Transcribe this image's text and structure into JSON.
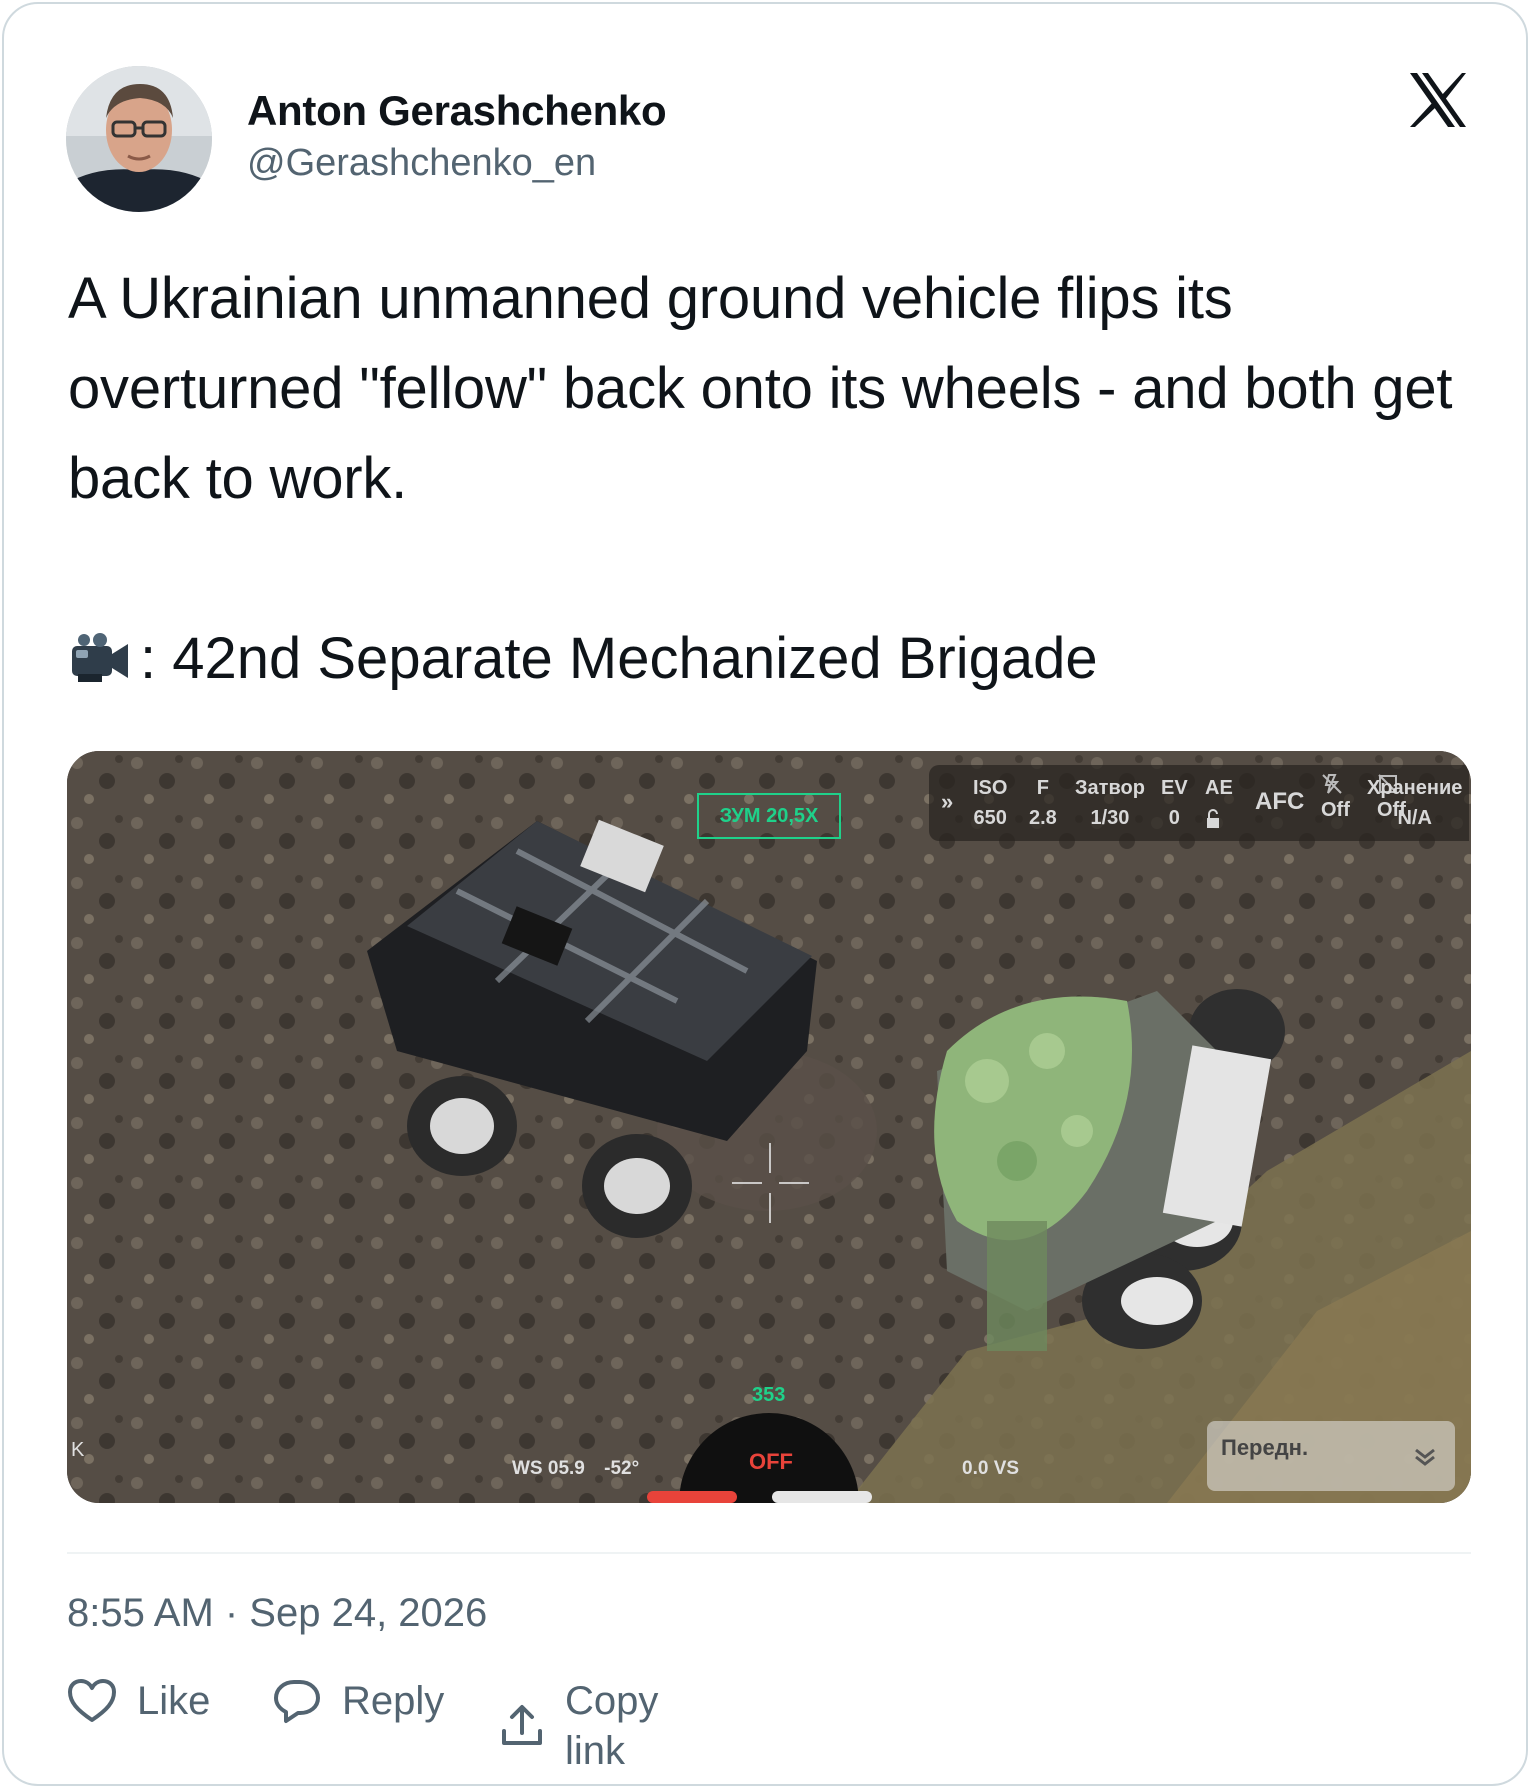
{
  "author": {
    "display_name": "Anton Gerashchenko",
    "handle": "@Gerashchenko_en"
  },
  "brand": {
    "icon": "x-logo-icon"
  },
  "tweet": {
    "text": "A Ukrainian unmanned ground vehicle flips its overturned \"fellow\" back onto its wheels - and both get back to work.",
    "source_label": ": 42nd Separate Mechanized Brigade",
    "source_icon": "video-camera-icon",
    "timestamp": "8:55 AM · Sep 24, 2026"
  },
  "media": {
    "hud": {
      "zoom": "ЗУМ 20,5X",
      "labels": [
        "ISO",
        "F",
        "Затвор",
        "EV",
        "AE",
        "Хранение"
      ],
      "values": [
        "650",
        "2.8",
        "1/30",
        "0",
        "Off",
        "Off",
        "N/A"
      ],
      "afc": "AFC",
      "heading": "353",
      "ws": "WS 05.9",
      "angle": "-52°",
      "mode": "OFF",
      "vs": "0.0 VS",
      "forward": "Передн.",
      "left_marker": "K"
    }
  },
  "actions": {
    "like_label": "Like",
    "reply_label": "Reply",
    "copy_label": "Copy link"
  },
  "colors": {
    "text": "#0f1419",
    "secondary": "#536471",
    "border": "#cfd9de",
    "hud_green": "#1fd18a",
    "hud_red": "#e8433a"
  }
}
